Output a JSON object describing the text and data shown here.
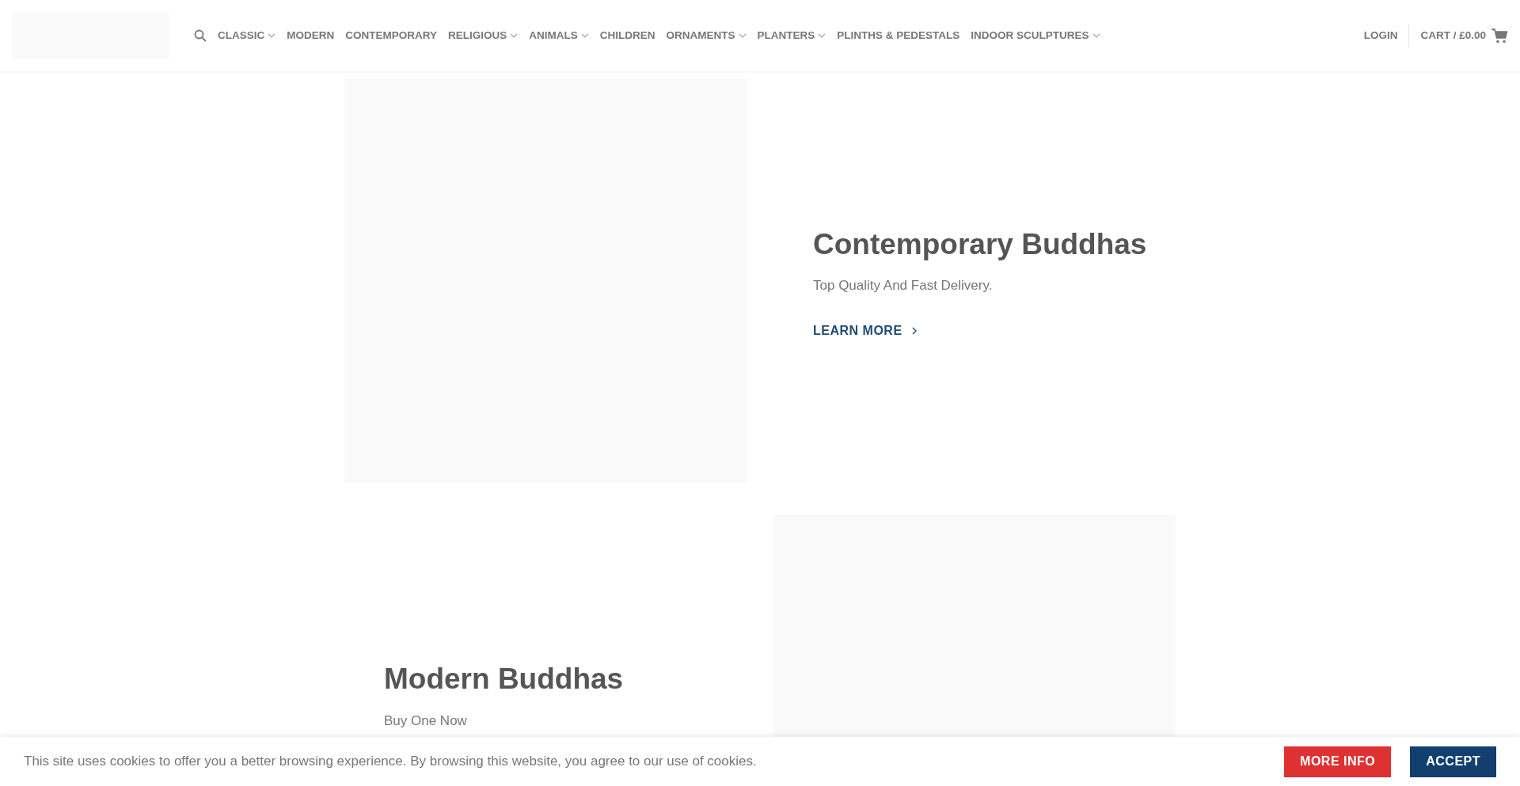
{
  "header": {
    "nav": [
      {
        "label": "CLASSIC",
        "has_dropdown": true
      },
      {
        "label": "MODERN",
        "has_dropdown": false
      },
      {
        "label": "CONTEMPORARY",
        "has_dropdown": false
      },
      {
        "label": "RELIGIOUS",
        "has_dropdown": true
      },
      {
        "label": "ANIMALS",
        "has_dropdown": true
      },
      {
        "label": "CHILDREN",
        "has_dropdown": false
      },
      {
        "label": "ORNAMENTS",
        "has_dropdown": true
      },
      {
        "label": "PLANTERS",
        "has_dropdown": true
      },
      {
        "label": "PLINTHS & PEDESTALS",
        "has_dropdown": false
      },
      {
        "label": "INDOOR SCULPTURES",
        "has_dropdown": true
      }
    ],
    "login": "LOGIN",
    "cart": "CART / £0.00"
  },
  "sections": [
    {
      "kind": "image_left",
      "title": "Contemporary Buddhas",
      "text": "Top Quality And Fast Delivery.",
      "link": "LEARN MORE"
    },
    {
      "kind": "image_right",
      "title": "Modern Buddhas",
      "text": "Buy One Now"
    }
  ],
  "cookie_bar": {
    "message": "This site uses cookies to offer you a better browsing experience. By browsing this website, you agree to our use of cookies.",
    "buttons": [
      {
        "label": "MORE INFO",
        "kind": "secondary"
      },
      {
        "label": "ACCEPT",
        "kind": "primary"
      }
    ]
  }
}
